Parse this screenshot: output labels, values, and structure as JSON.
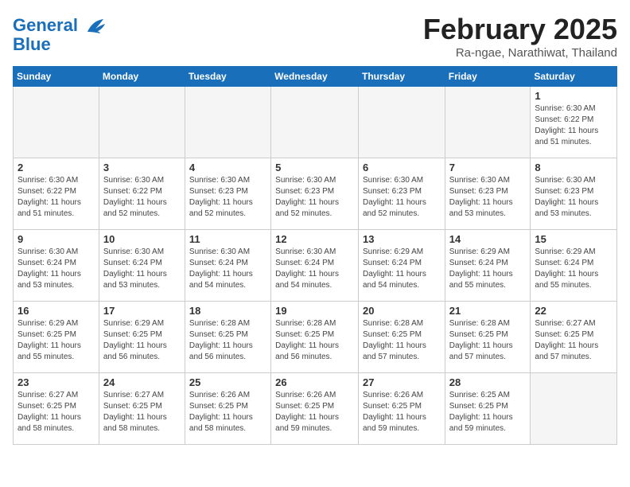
{
  "header": {
    "logo_line1": "General",
    "logo_line2": "Blue",
    "title": "February 2025",
    "subtitle": "Ra-ngae, Narathiwat, Thailand"
  },
  "weekdays": [
    "Sunday",
    "Monday",
    "Tuesday",
    "Wednesday",
    "Thursday",
    "Friday",
    "Saturday"
  ],
  "weeks": [
    [
      {
        "day": "",
        "info": ""
      },
      {
        "day": "",
        "info": ""
      },
      {
        "day": "",
        "info": ""
      },
      {
        "day": "",
        "info": ""
      },
      {
        "day": "",
        "info": ""
      },
      {
        "day": "",
        "info": ""
      },
      {
        "day": "1",
        "info": "Sunrise: 6:30 AM\nSunset: 6:22 PM\nDaylight: 11 hours\nand 51 minutes."
      }
    ],
    [
      {
        "day": "2",
        "info": "Sunrise: 6:30 AM\nSunset: 6:22 PM\nDaylight: 11 hours\nand 51 minutes."
      },
      {
        "day": "3",
        "info": "Sunrise: 6:30 AM\nSunset: 6:22 PM\nDaylight: 11 hours\nand 52 minutes."
      },
      {
        "day": "4",
        "info": "Sunrise: 6:30 AM\nSunset: 6:23 PM\nDaylight: 11 hours\nand 52 minutes."
      },
      {
        "day": "5",
        "info": "Sunrise: 6:30 AM\nSunset: 6:23 PM\nDaylight: 11 hours\nand 52 minutes."
      },
      {
        "day": "6",
        "info": "Sunrise: 6:30 AM\nSunset: 6:23 PM\nDaylight: 11 hours\nand 52 minutes."
      },
      {
        "day": "7",
        "info": "Sunrise: 6:30 AM\nSunset: 6:23 PM\nDaylight: 11 hours\nand 53 minutes."
      },
      {
        "day": "8",
        "info": "Sunrise: 6:30 AM\nSunset: 6:23 PM\nDaylight: 11 hours\nand 53 minutes."
      }
    ],
    [
      {
        "day": "9",
        "info": "Sunrise: 6:30 AM\nSunset: 6:24 PM\nDaylight: 11 hours\nand 53 minutes."
      },
      {
        "day": "10",
        "info": "Sunrise: 6:30 AM\nSunset: 6:24 PM\nDaylight: 11 hours\nand 53 minutes."
      },
      {
        "day": "11",
        "info": "Sunrise: 6:30 AM\nSunset: 6:24 PM\nDaylight: 11 hours\nand 54 minutes."
      },
      {
        "day": "12",
        "info": "Sunrise: 6:30 AM\nSunset: 6:24 PM\nDaylight: 11 hours\nand 54 minutes."
      },
      {
        "day": "13",
        "info": "Sunrise: 6:29 AM\nSunset: 6:24 PM\nDaylight: 11 hours\nand 54 minutes."
      },
      {
        "day": "14",
        "info": "Sunrise: 6:29 AM\nSunset: 6:24 PM\nDaylight: 11 hours\nand 55 minutes."
      },
      {
        "day": "15",
        "info": "Sunrise: 6:29 AM\nSunset: 6:24 PM\nDaylight: 11 hours\nand 55 minutes."
      }
    ],
    [
      {
        "day": "16",
        "info": "Sunrise: 6:29 AM\nSunset: 6:25 PM\nDaylight: 11 hours\nand 55 minutes."
      },
      {
        "day": "17",
        "info": "Sunrise: 6:29 AM\nSunset: 6:25 PM\nDaylight: 11 hours\nand 56 minutes."
      },
      {
        "day": "18",
        "info": "Sunrise: 6:28 AM\nSunset: 6:25 PM\nDaylight: 11 hours\nand 56 minutes."
      },
      {
        "day": "19",
        "info": "Sunrise: 6:28 AM\nSunset: 6:25 PM\nDaylight: 11 hours\nand 56 minutes."
      },
      {
        "day": "20",
        "info": "Sunrise: 6:28 AM\nSunset: 6:25 PM\nDaylight: 11 hours\nand 57 minutes."
      },
      {
        "day": "21",
        "info": "Sunrise: 6:28 AM\nSunset: 6:25 PM\nDaylight: 11 hours\nand 57 minutes."
      },
      {
        "day": "22",
        "info": "Sunrise: 6:27 AM\nSunset: 6:25 PM\nDaylight: 11 hours\nand 57 minutes."
      }
    ],
    [
      {
        "day": "23",
        "info": "Sunrise: 6:27 AM\nSunset: 6:25 PM\nDaylight: 11 hours\nand 58 minutes."
      },
      {
        "day": "24",
        "info": "Sunrise: 6:27 AM\nSunset: 6:25 PM\nDaylight: 11 hours\nand 58 minutes."
      },
      {
        "day": "25",
        "info": "Sunrise: 6:26 AM\nSunset: 6:25 PM\nDaylight: 11 hours\nand 58 minutes."
      },
      {
        "day": "26",
        "info": "Sunrise: 6:26 AM\nSunset: 6:25 PM\nDaylight: 11 hours\nand 59 minutes."
      },
      {
        "day": "27",
        "info": "Sunrise: 6:26 AM\nSunset: 6:25 PM\nDaylight: 11 hours\nand 59 minutes."
      },
      {
        "day": "28",
        "info": "Sunrise: 6:25 AM\nSunset: 6:25 PM\nDaylight: 11 hours\nand 59 minutes."
      },
      {
        "day": "",
        "info": ""
      }
    ]
  ]
}
